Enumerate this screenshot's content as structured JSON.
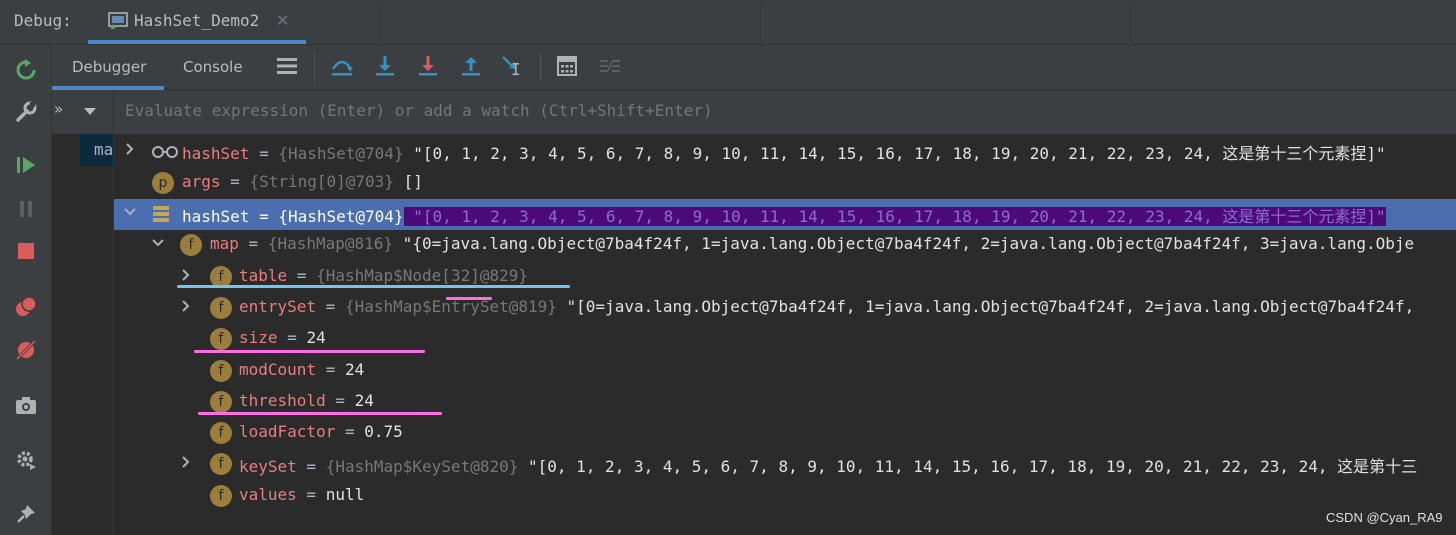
{
  "window": {
    "debug_label": "Debug:",
    "session_tab": "HashSet_Demo2",
    "close_glyph": "✕"
  },
  "tabs": {
    "debugger": "Debugger",
    "console": "Console"
  },
  "frames": {
    "current_frame": "ma",
    "more_glyph": "»"
  },
  "evaluate": {
    "placeholder": "Evaluate expression (Enter) or add a watch (Ctrl+Shift+Enter)"
  },
  "variables": [
    {
      "name": "hashSet",
      "eq": " = ",
      "ref": "{HashSet@704}",
      "value": " \"[0, 1, 2, 3, 4, 5, 6, 7, 8, 9, 10, 11, 14, 15, 16, 17, 18, 19, 20, 21, 22, 23, 24, 这是第十三个元素捏]\"",
      "kind": "watch",
      "expandable": true
    },
    {
      "name": "args",
      "eq": " = ",
      "ref": "{String[0]@703}",
      "value": " []",
      "kind": "p"
    },
    {
      "name": "hashSet",
      "eq": " = ",
      "ref": "{HashSet@704}",
      "value": " \"[0, 1, 2, 3, 4, 5, 6, 7, 8, 9, 10, 11, 14, 15, 16, 17, 18, 19, 20, 21, 22, 23, 24, 这是第十三个元素捏]\"",
      "kind": "list",
      "selected": true
    },
    {
      "name": "map",
      "eq": " = ",
      "ref": "{HashMap@816}",
      "value": " \"{0=java.lang.Object@7ba4f24f, 1=java.lang.Object@7ba4f24f, 2=java.lang.Object@7ba4f24f, 3=java.lang.Obje",
      "kind": "f"
    },
    {
      "name": "table",
      "eq": " = ",
      "ref": "{HashMap$Node[32]@829}",
      "value": "",
      "kind": "f"
    },
    {
      "name": "entrySet",
      "eq": " = ",
      "ref": "{HashMap$EntrySet@819}",
      "value": " \"[0=java.lang.Object@7ba4f24f, 1=java.lang.Object@7ba4f24f, 2=java.lang.Object@7ba4f24f,",
      "kind": "f"
    },
    {
      "name": "size",
      "eq": " = ",
      "ref": "",
      "value": "24",
      "kind": "f"
    },
    {
      "name": "modCount",
      "eq": " = ",
      "ref": "",
      "value": "24",
      "kind": "f"
    },
    {
      "name": "threshold",
      "eq": " = ",
      "ref": "",
      "value": "24",
      "kind": "f"
    },
    {
      "name": "loadFactor",
      "eq": " = ",
      "ref": "",
      "value": "0.75",
      "kind": "f"
    },
    {
      "name": "keySet",
      "eq": " = ",
      "ref": "{HashMap$KeySet@820}",
      "value": " \"[0, 1, 2, 3, 4, 5, 6, 7, 8, 9, 10, 11, 14, 15, 16, 17, 18, 19, 20, 21, 22, 23, 24, 这是第十三",
      "kind": "f"
    },
    {
      "name": "values",
      "eq": " = ",
      "ref": "",
      "value": "null",
      "kind": "f"
    }
  ],
  "icon_letters": {
    "field": "f",
    "param": "p"
  },
  "watermark": "CSDN @Cyan_RA9",
  "colors": {
    "accent": "#4a88c7",
    "selection": "#4b6eaf",
    "annotation_pink": "#ff6ee7",
    "annotation_blue": "#6fc6f0",
    "highlight": "#4c0a78"
  }
}
